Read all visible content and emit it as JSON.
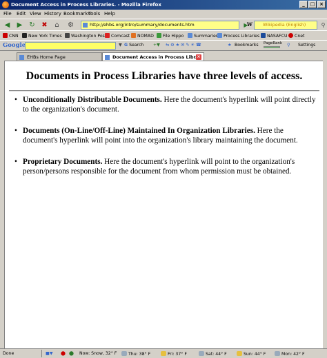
{
  "window": {
    "title": "Document Access in Process Libraries. - Mozilla Firefox",
    "buttons": {
      "minimize": "_",
      "maximize": "□",
      "close": "×"
    }
  },
  "menu": [
    "File",
    "Edit",
    "View",
    "History",
    "Bookmarks",
    "Tools",
    "Help"
  ],
  "navigation": {
    "url": "http://ehbs.org/intro/summary/documents.htm",
    "search_engine_label": "W",
    "search_placeholder": "Wikipedia (English)"
  },
  "bookmarks": [
    "CNN",
    "New York Times",
    "Washington Post",
    "Comcast",
    "NOMAD",
    "File Hippo",
    "Summaries",
    "Process Libraries",
    "NASAFCU",
    "Cnet"
  ],
  "google_toolbar": {
    "logo": "Google",
    "search_button": "Search",
    "bookmarks_label": "Bookmarks",
    "pagerank_label": "PageRank",
    "settings_label": "Settings"
  },
  "tabs": [
    {
      "label": "EHBs Home Page",
      "active": false
    },
    {
      "label": "Document Access in Process Libr...",
      "active": true
    }
  ],
  "page": {
    "title": "Documents in Process Libraries have three levels of access.",
    "items": [
      {
        "term": "Unconditionally Distributable Documents.",
        "text": " Here the document's hyperlink will point directly to the organization's document."
      },
      {
        "term": "Documents (On-Line/Off-Line) Maintained In Organization Libraries.",
        "text": " Here the document's hyperlink will point into the organization's library maintaining the document."
      },
      {
        "term": "Proprietary Documents.",
        "text": " Here the document's hyperlink will point to the organization's person/persons responsible for the document from whom permission must be obtained."
      }
    ]
  },
  "status": {
    "text": "Done",
    "weather": [
      "Now: Snow, 32° F",
      "Thu: 38° F",
      "Fri: 37° F",
      "Sat: 44° F",
      "Sun: 44° F",
      "Mon: 42° F"
    ]
  },
  "colors": {
    "title_bar_start": "#0a246a",
    "title_bar_end": "#3a6ea5",
    "url_bar_bg": "#ffff88",
    "google_search_bg": "#ffff66"
  }
}
